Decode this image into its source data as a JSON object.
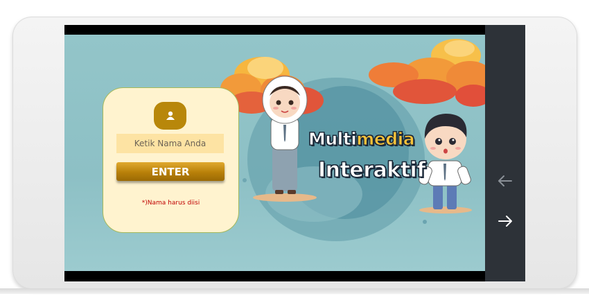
{
  "login": {
    "avatar_icon": "user-icon",
    "name_placeholder": "Ketik Nama Anda",
    "enter_label": "ENTER",
    "required_note": "*)Nama harus diisi"
  },
  "banner": {
    "title_part1_white": "Multi",
    "title_part1_highlight": "media",
    "title_part2": "Interaktif"
  },
  "navigation": {
    "back_icon": "arrow-left-icon",
    "forward_icon": "arrow-right-icon"
  },
  "colors": {
    "background": "#93c5c9",
    "card": "#fff3cf",
    "accent": "#b8870a",
    "note": "#c00000",
    "navbar": "#2d3238"
  }
}
